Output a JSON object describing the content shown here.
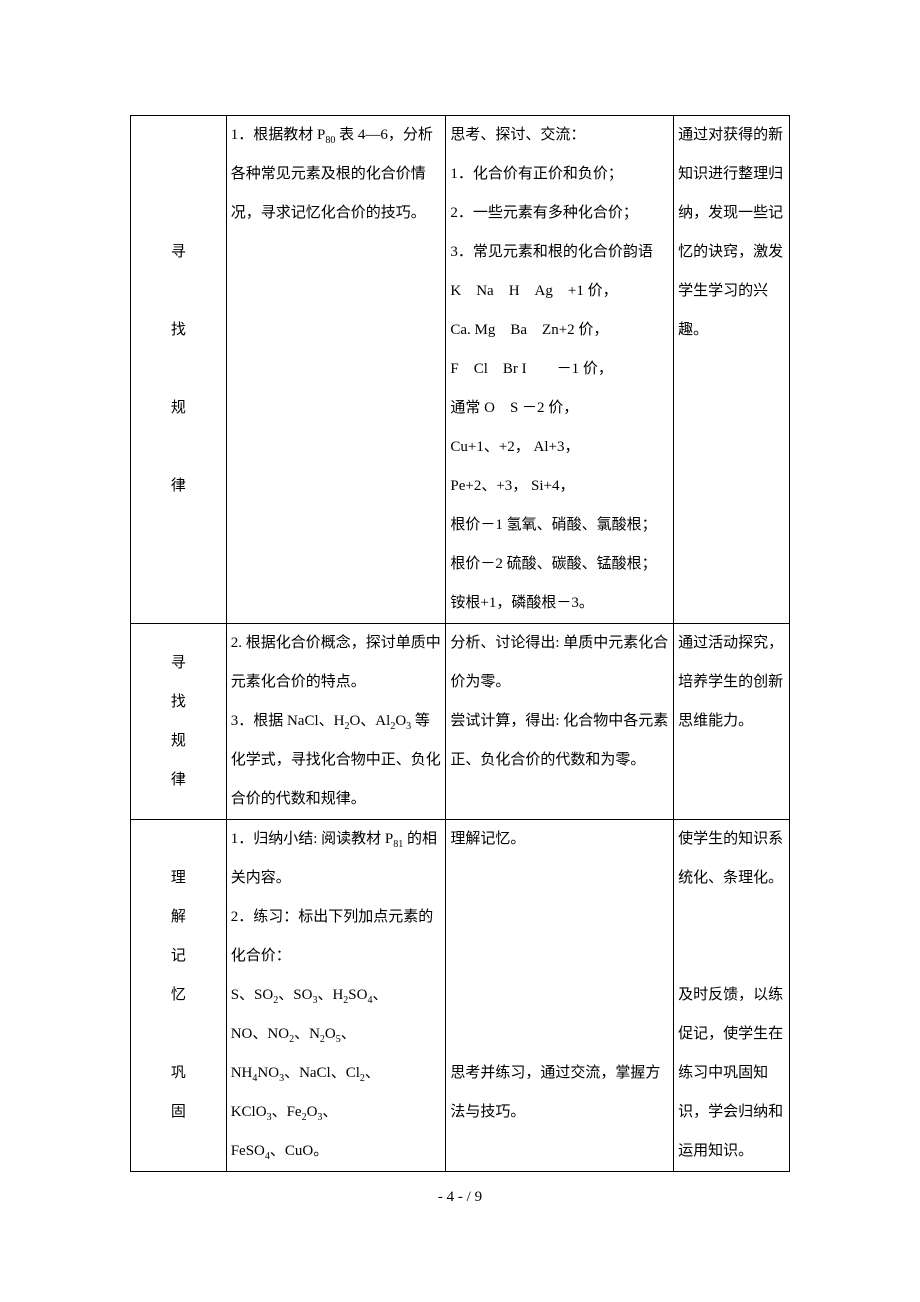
{
  "rows": [
    {
      "col1": "寻\n\n找\n\n规\n\n律",
      "col2": "1．根据教材 P₈₀ 表 4—6，分析各种常见元素及根的化合价情况，寻求记忆化合价的技巧。",
      "col3": "思考、探讨、交流：\n1．化合价有正价和负价；\n2．一些元素有多种化合价；\n3．常见元素和根的化合价韵语\nK　Na　H　Ag　+1 价，\n Ca. Mg　Ba　Zn+2 价，\nF　Cl　Br I　　－1 价，\n通常 O　S －2 价，\n Cu+1、+2， Al+3，\n Pe+2、+3， Si+4，\n根价－1 氢氧、硝酸、氯酸根；\n根价－2 硫酸、碳酸、锰酸根；\n铵根+1，磷酸根－3。",
      "col4": "通过对获得的新知识进行整理归纳，发现一些记忆的诀窍，激发学生学习的兴趣。"
    },
    {
      "col1": "寻\n找\n规\n律",
      "col2": "2. 根据化合价概念，探讨单质中元素化合价的特点。\n3．根据 NaCl、H₂O、Al₂O₃ 等化学式，寻找化合物中正、负化合价的代数和规律。",
      "col3": "分析、讨论得出: 单质中元素化合价为零。\n尝试计算，得出: 化合物中各元素正、负化合价的代数和为零。",
      "col4": "通过活动探究，培养学生的创新\n思维能力。"
    },
    {
      "col1": "理\n解\n记\n忆\n\n巩\n固",
      "col2": "1．归纳小结: 阅读教材 P₈₁ 的相关内容。\n2．练习：标出下列加点元素的化合价：\nS、SO₂、SO₃、H₂SO₄、\nNO、NO₂、N₂O₅、\nNH₄NO₃、NaCl、Cl₂、\nKClO₃、Fe₂O₃、\nFeSO₄、CuO。",
      "col3": "理解记忆。\n\n\n\n\n\n思考并练习，通过交流，掌握方法与技巧。",
      "col4": "使学生的知识系统化、条理化。\n\n\n及时反馈，以练促记，使学生在练习中巩固知识，学会归纳和运用知识。"
    }
  ],
  "footer": "- 4 - / 9"
}
